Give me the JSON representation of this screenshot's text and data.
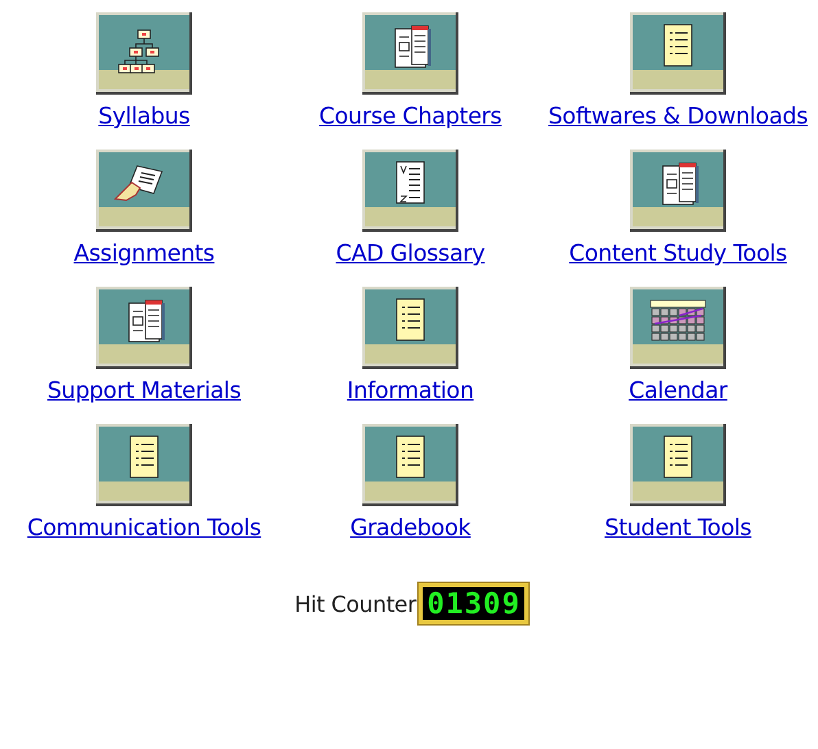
{
  "links": [
    {
      "label": "Syllabus",
      "kind": "hierarchy"
    },
    {
      "label": "Course Chapters",
      "kind": "book"
    },
    {
      "label": "Softwares & Downloads",
      "kind": "notepad"
    },
    {
      "label": "Assignments",
      "kind": "hand"
    },
    {
      "label": "CAD Glossary",
      "kind": "glossary"
    },
    {
      "label": "Content Study Tools",
      "kind": "book"
    },
    {
      "label": "Support Materials",
      "kind": "book"
    },
    {
      "label": "Information",
      "kind": "notepad"
    },
    {
      "label": "Calendar",
      "kind": "calendar"
    },
    {
      "label": "Communication Tools",
      "kind": "notepad"
    },
    {
      "label": "Gradebook",
      "kind": "notepad"
    },
    {
      "label": "Student Tools",
      "kind": "notepad"
    }
  ],
  "hit_counter": {
    "label": "Hit Counter",
    "value": "01309"
  }
}
